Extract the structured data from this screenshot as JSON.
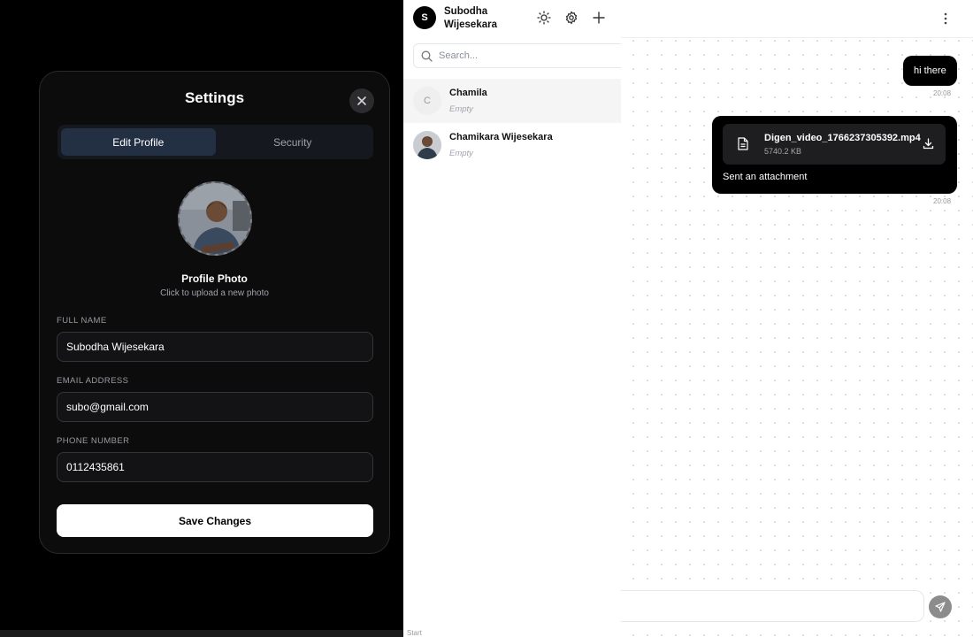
{
  "settings": {
    "title": "Settings",
    "tabs": [
      {
        "label": "Edit Profile",
        "active": true
      },
      {
        "label": "Security",
        "active": false
      }
    ],
    "photo_title": "Profile Photo",
    "photo_hint": "Click to upload a new photo",
    "fields": {
      "full_name": {
        "label": "FULL NAME",
        "value": "Subodha Wijesekara"
      },
      "email": {
        "label": "EMAIL ADDRESS",
        "value": "subo@gmail.com"
      },
      "phone": {
        "label": "PHONE NUMBER",
        "value": "0112435861"
      }
    },
    "save_label": "Save Changes"
  },
  "sidebar": {
    "user": {
      "initial": "S",
      "name": "Subodha Wijesekara"
    },
    "search_placeholder": "Search...",
    "contacts": [
      {
        "initial": "C",
        "name": "Chamila",
        "preview": "Empty",
        "active": true
      },
      {
        "initial": "",
        "name": "Chamikara Wijesekara",
        "preview": "Empty",
        "active": false
      }
    ],
    "footer_hint": "Start"
  },
  "chat": {
    "messages": [
      {
        "type": "text",
        "text": "hi there",
        "time": "20:08"
      },
      {
        "type": "attachment",
        "file_name": "Digen_video_1766237305392.mp4",
        "file_size": "5740.2 KB",
        "caption": "Sent an attachment",
        "time": "20:08"
      }
    ]
  },
  "icons": {
    "close": "close-icon",
    "theme": "sun-icon",
    "settings": "gear-icon",
    "new_chat": "plus-icon",
    "search": "search-icon",
    "menu": "kebab-icon",
    "file": "file-icon",
    "download": "download-icon",
    "send": "send-icon"
  },
  "colors": {
    "modal_bg": "#0c0c0d",
    "tab_active": "#233044",
    "bubble": "#000000",
    "send_button": "#8c8c8c"
  }
}
